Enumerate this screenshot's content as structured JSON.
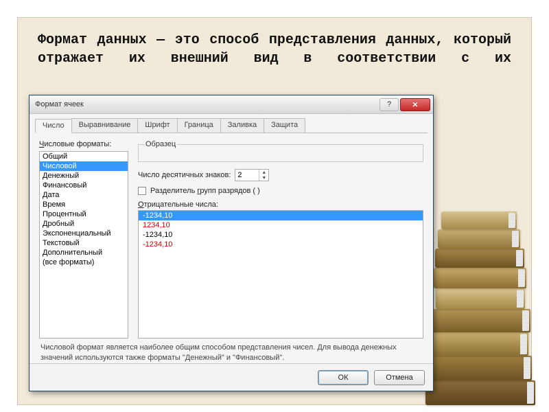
{
  "slide": {
    "text": "Формат данных — это способ представления данных, который отражает их внешний вид в соответствии с их"
  },
  "dialog": {
    "title": "Формат ячеек",
    "help": "?",
    "close": "✕",
    "tabs": [
      "Число",
      "Выравнивание",
      "Шрифт",
      "Граница",
      "Заливка",
      "Защита"
    ],
    "formats_label": "Числовые форматы:",
    "formats": [
      "Общий",
      "Числовой",
      "Денежный",
      "Финансовый",
      "Дата",
      "Время",
      "Процентный",
      "Дробный",
      "Экспоненциальный",
      "Текстовый",
      "Дополнительный",
      "(все форматы)"
    ],
    "selected_format_index": 1,
    "sample_label": "Образец",
    "decimal_label_pre": "Число ",
    "decimal_label_u": "д",
    "decimal_label_post": "есятичных знаков:",
    "decimal_value": "2",
    "separator_pre": "Разделитель ",
    "separator_u": "г",
    "separator_post": "рупп разрядов ( )",
    "negative_label": "Отрицательные числа:",
    "negatives": [
      {
        "text": "-1234,10",
        "sel": true,
        "red": false
      },
      {
        "text": "1234,10",
        "sel": false,
        "red": true
      },
      {
        "text": "-1234,10",
        "sel": false,
        "red": false
      },
      {
        "text": "-1234,10",
        "sel": false,
        "red": true
      }
    ],
    "desc": "Числовой формат является наиболее общим способом представления чисел. Для вывода денежных значений используются также форматы \"Денежный\" и \"Финансовый\".",
    "ok": "ОК",
    "cancel": "Отмена"
  }
}
